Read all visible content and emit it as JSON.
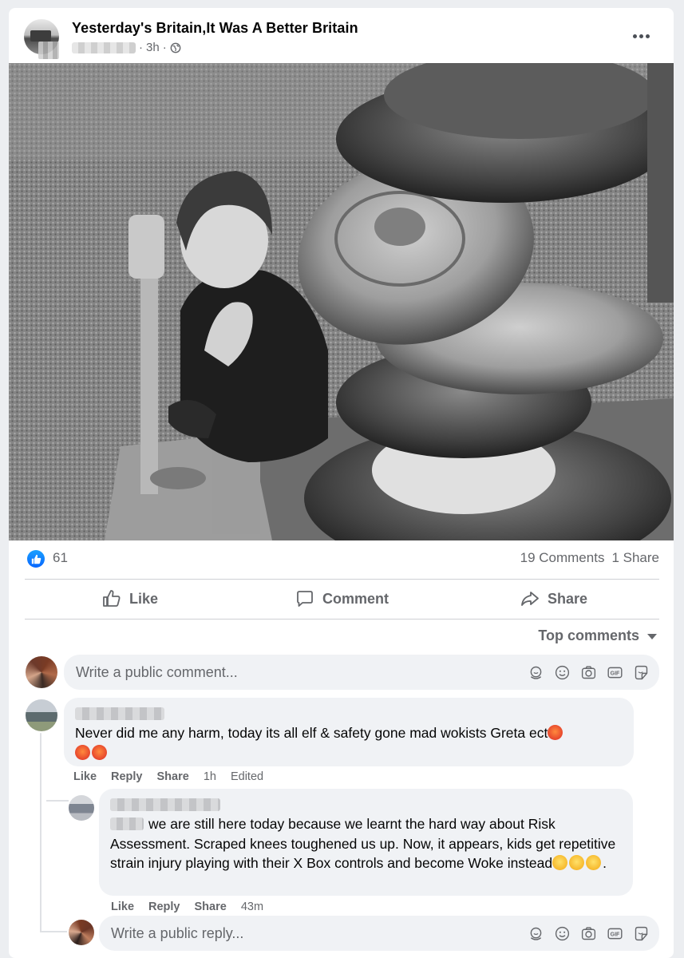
{
  "post": {
    "page_name": "Yesterday's Britain,It Was A Better Britain",
    "time": "3h",
    "separator": "·"
  },
  "stats": {
    "reactions": "61",
    "comments": "19 Comments",
    "shares": "1 Share"
  },
  "actions": {
    "like": "Like",
    "comment": "Comment",
    "share": "Share"
  },
  "sort": {
    "label": "Top comments"
  },
  "composer": {
    "placeholder": "Write a public comment..."
  },
  "comments": [
    {
      "text": "Never did me any harm, today its all elf & safety gone mad wokists Greta ect",
      "like": "Like",
      "reply": "Reply",
      "share": "Share",
      "time": "1h",
      "edited": "Edited"
    },
    {
      "text": "we are still here today because we learnt the hard way about Risk Assessment. Scraped knees toughened us up. Now, it appears, kids get repetitive strain injury playing with their X Box controls and become Woke instead",
      "text_end": ".",
      "like": "Like",
      "reply": "Reply",
      "share": "Share",
      "time": "43m"
    }
  ],
  "reply_composer": {
    "placeholder": "Write a public reply..."
  },
  "icons": {
    "like": "thumbs-up-icon",
    "comment": "speech-bubble-icon",
    "share": "share-arrow-icon",
    "globe": "globe-icon",
    "sticker": "sticker-icon",
    "emoji": "smiley-icon",
    "camera": "camera-icon",
    "gif": "gif-icon",
    "avatar-sticker": "avatar-sticker-icon"
  },
  "colors": {
    "accent": "#0866ff",
    "muted": "#65676b",
    "bubble": "#f0f2f5"
  }
}
